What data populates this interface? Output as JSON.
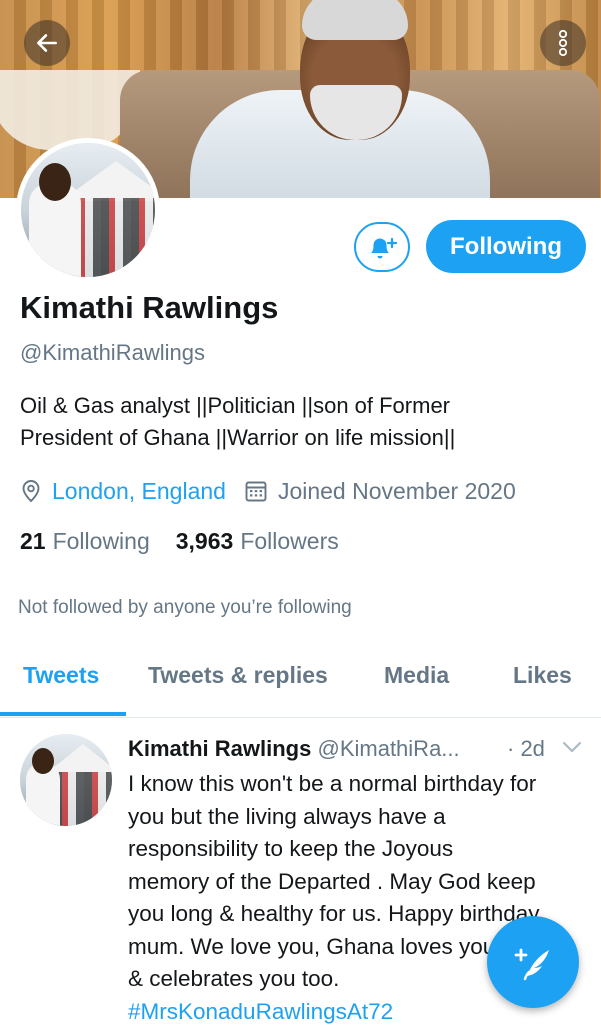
{
  "profile": {
    "name": "Kimathi Rawlings",
    "handle": "@KimathiRawlings",
    "bio_line1": "Oil & Gas analyst ||Politician ||son of Former",
    "bio_line2": "President of Ghana ||Warrior on life mission||",
    "location": "London, England",
    "joined": "Joined November 2020",
    "following_count": "21",
    "following_label": "Following",
    "followers_count": "3,963",
    "followers_label": "Followers",
    "not_followed_text": "Not followed by anyone you’re following"
  },
  "actions": {
    "following_button": "Following",
    "notify_icon": "bell-plus-icon"
  },
  "tabs": [
    {
      "label": "Tweets",
      "active": true
    },
    {
      "label": "Tweets & replies",
      "active": false
    },
    {
      "label": "Media",
      "active": false
    },
    {
      "label": "Likes",
      "active": false
    }
  ],
  "tweet": {
    "author_name": "Kimathi Rawlings",
    "author_handle": "@KimathiRa...",
    "time": "· 2d",
    "lines": [
      "I know this won't be a normal birthday for",
      "you but the living always have a",
      "responsibility to keep the Joyous",
      "memory of the Departed . May God keep",
      "you long & healthy for us. Happy birthday",
      "mum. We love you, Ghana loves you",
      "& celebrates you too."
    ],
    "hashtag": "#MrsKonaduRawlingsAt72"
  },
  "colors": {
    "accent": "#1da1f2",
    "text_primary": "#14171a",
    "text_secondary": "#657786"
  }
}
